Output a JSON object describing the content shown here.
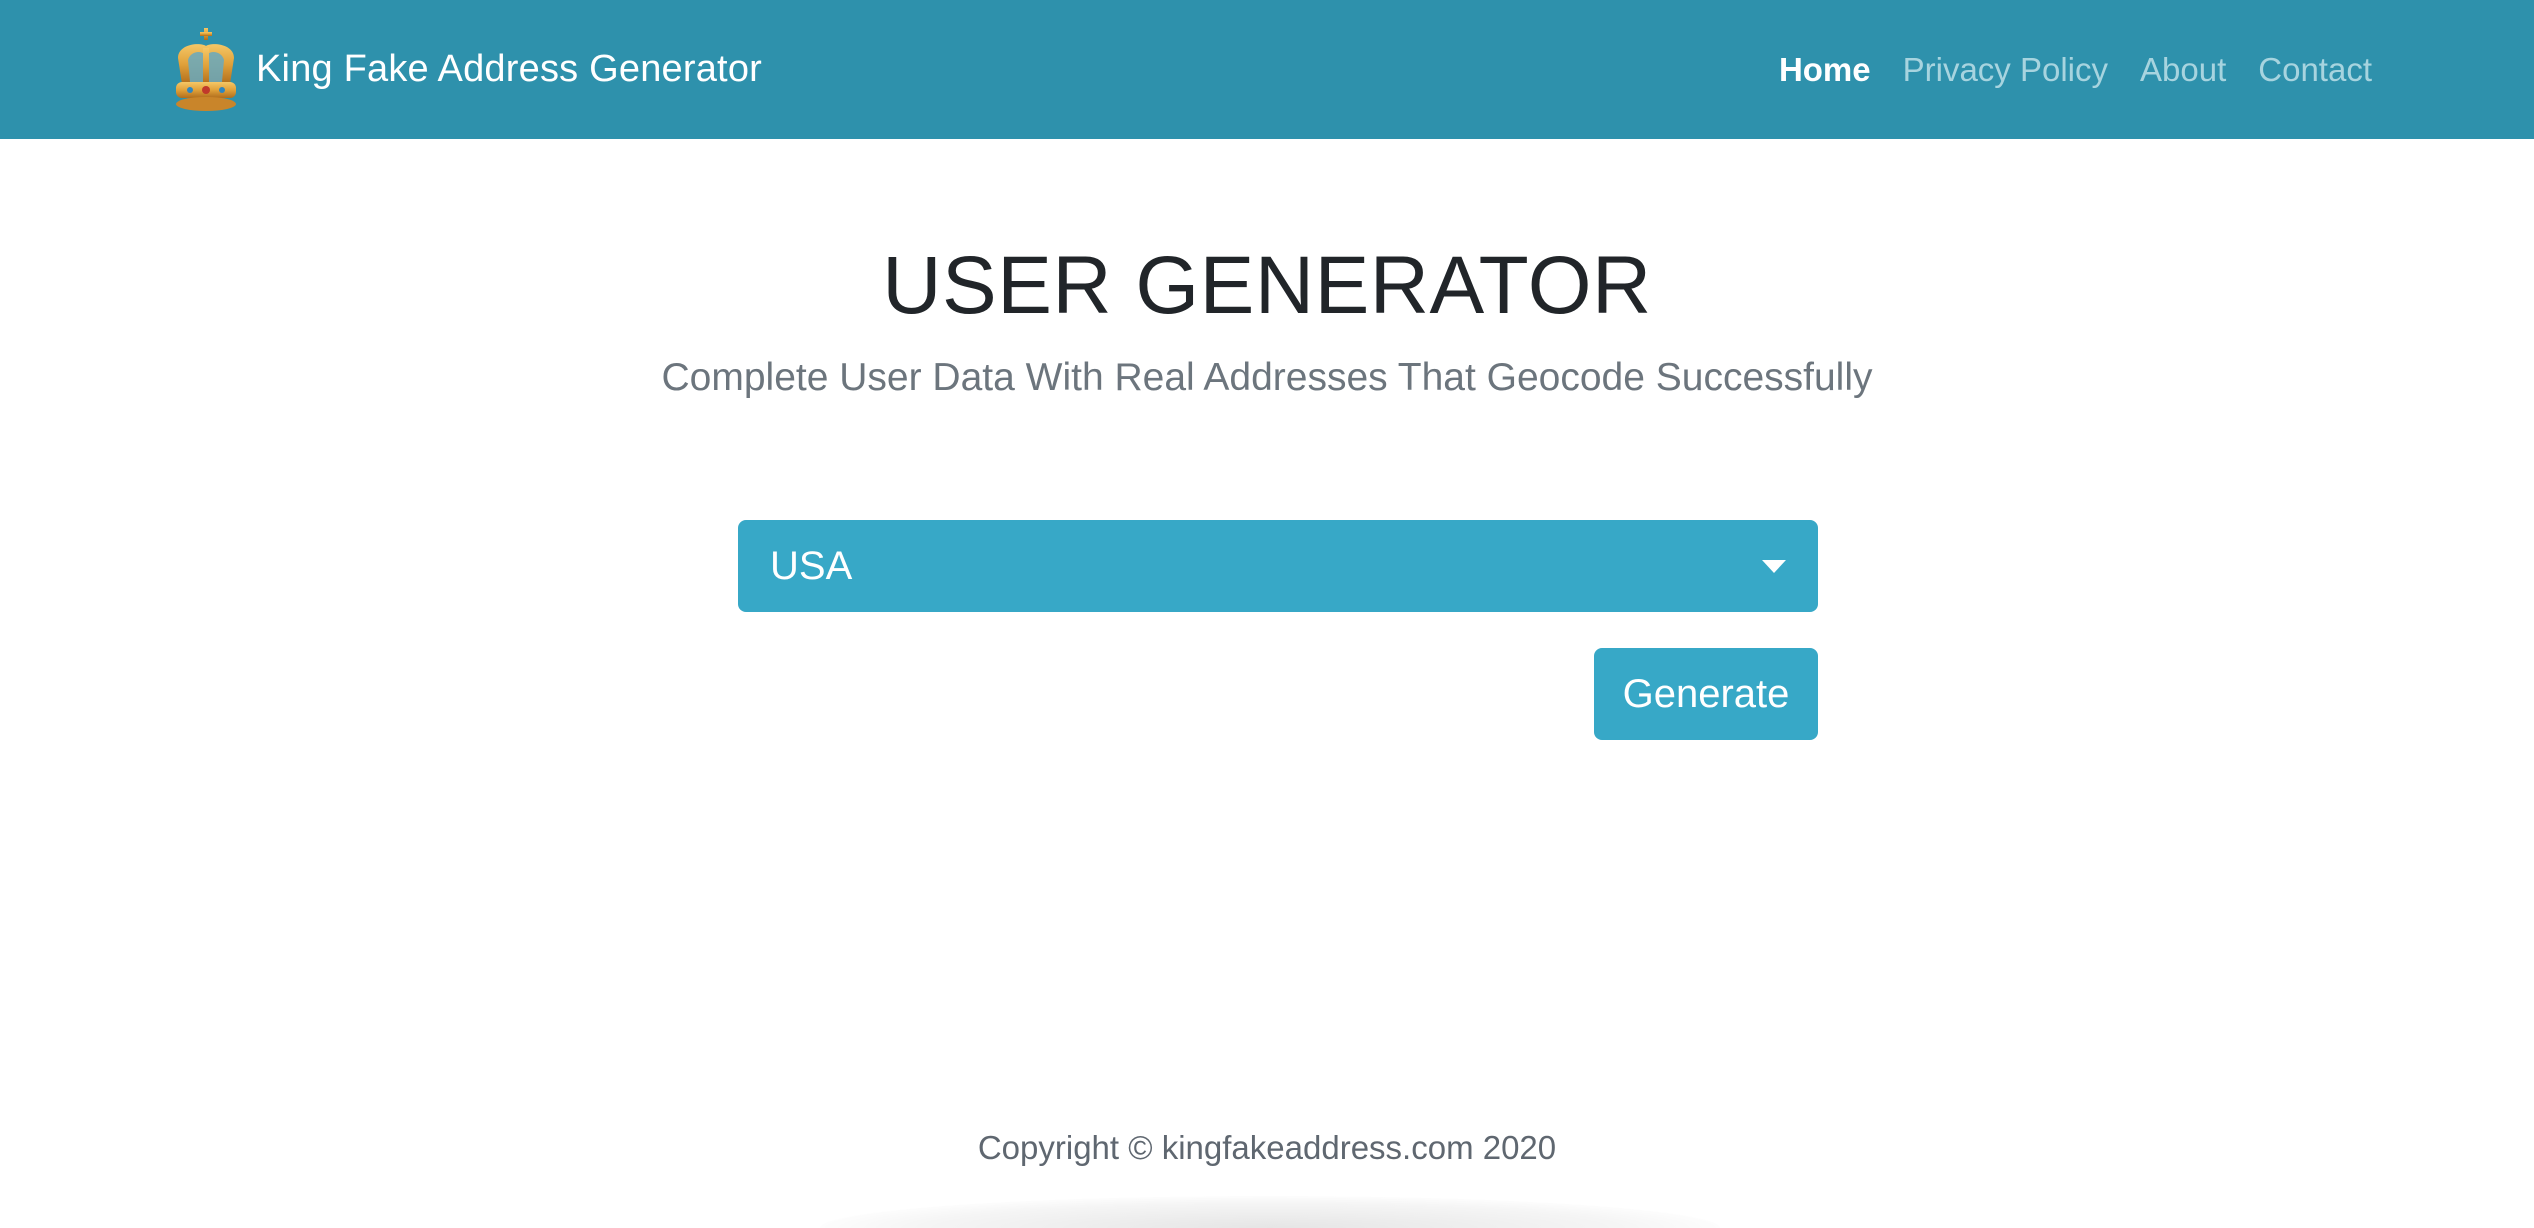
{
  "header": {
    "brand_title": "King Fake Address Generator",
    "logo_icon": "crown-icon",
    "nav": [
      {
        "label": "Home",
        "active": true
      },
      {
        "label": "Privacy Policy",
        "active": false
      },
      {
        "label": "About",
        "active": false
      },
      {
        "label": "Contact",
        "active": false
      }
    ]
  },
  "main": {
    "title": "USER GENERATOR",
    "subtitle": "Complete User Data With Real Addresses That Geocode Successfully",
    "country_select": {
      "selected": "USA",
      "icon": "chevron-down-icon"
    },
    "generate_label": "Generate"
  },
  "footer": {
    "copyright": "Copyright © kingfakeaddress.com 2020"
  },
  "colors": {
    "navbar_bg": "#2e91ac",
    "accent": "#37a8c7",
    "nav_inactive": "#a7d4df",
    "title_text": "#212529",
    "muted_text": "#6c757d"
  }
}
